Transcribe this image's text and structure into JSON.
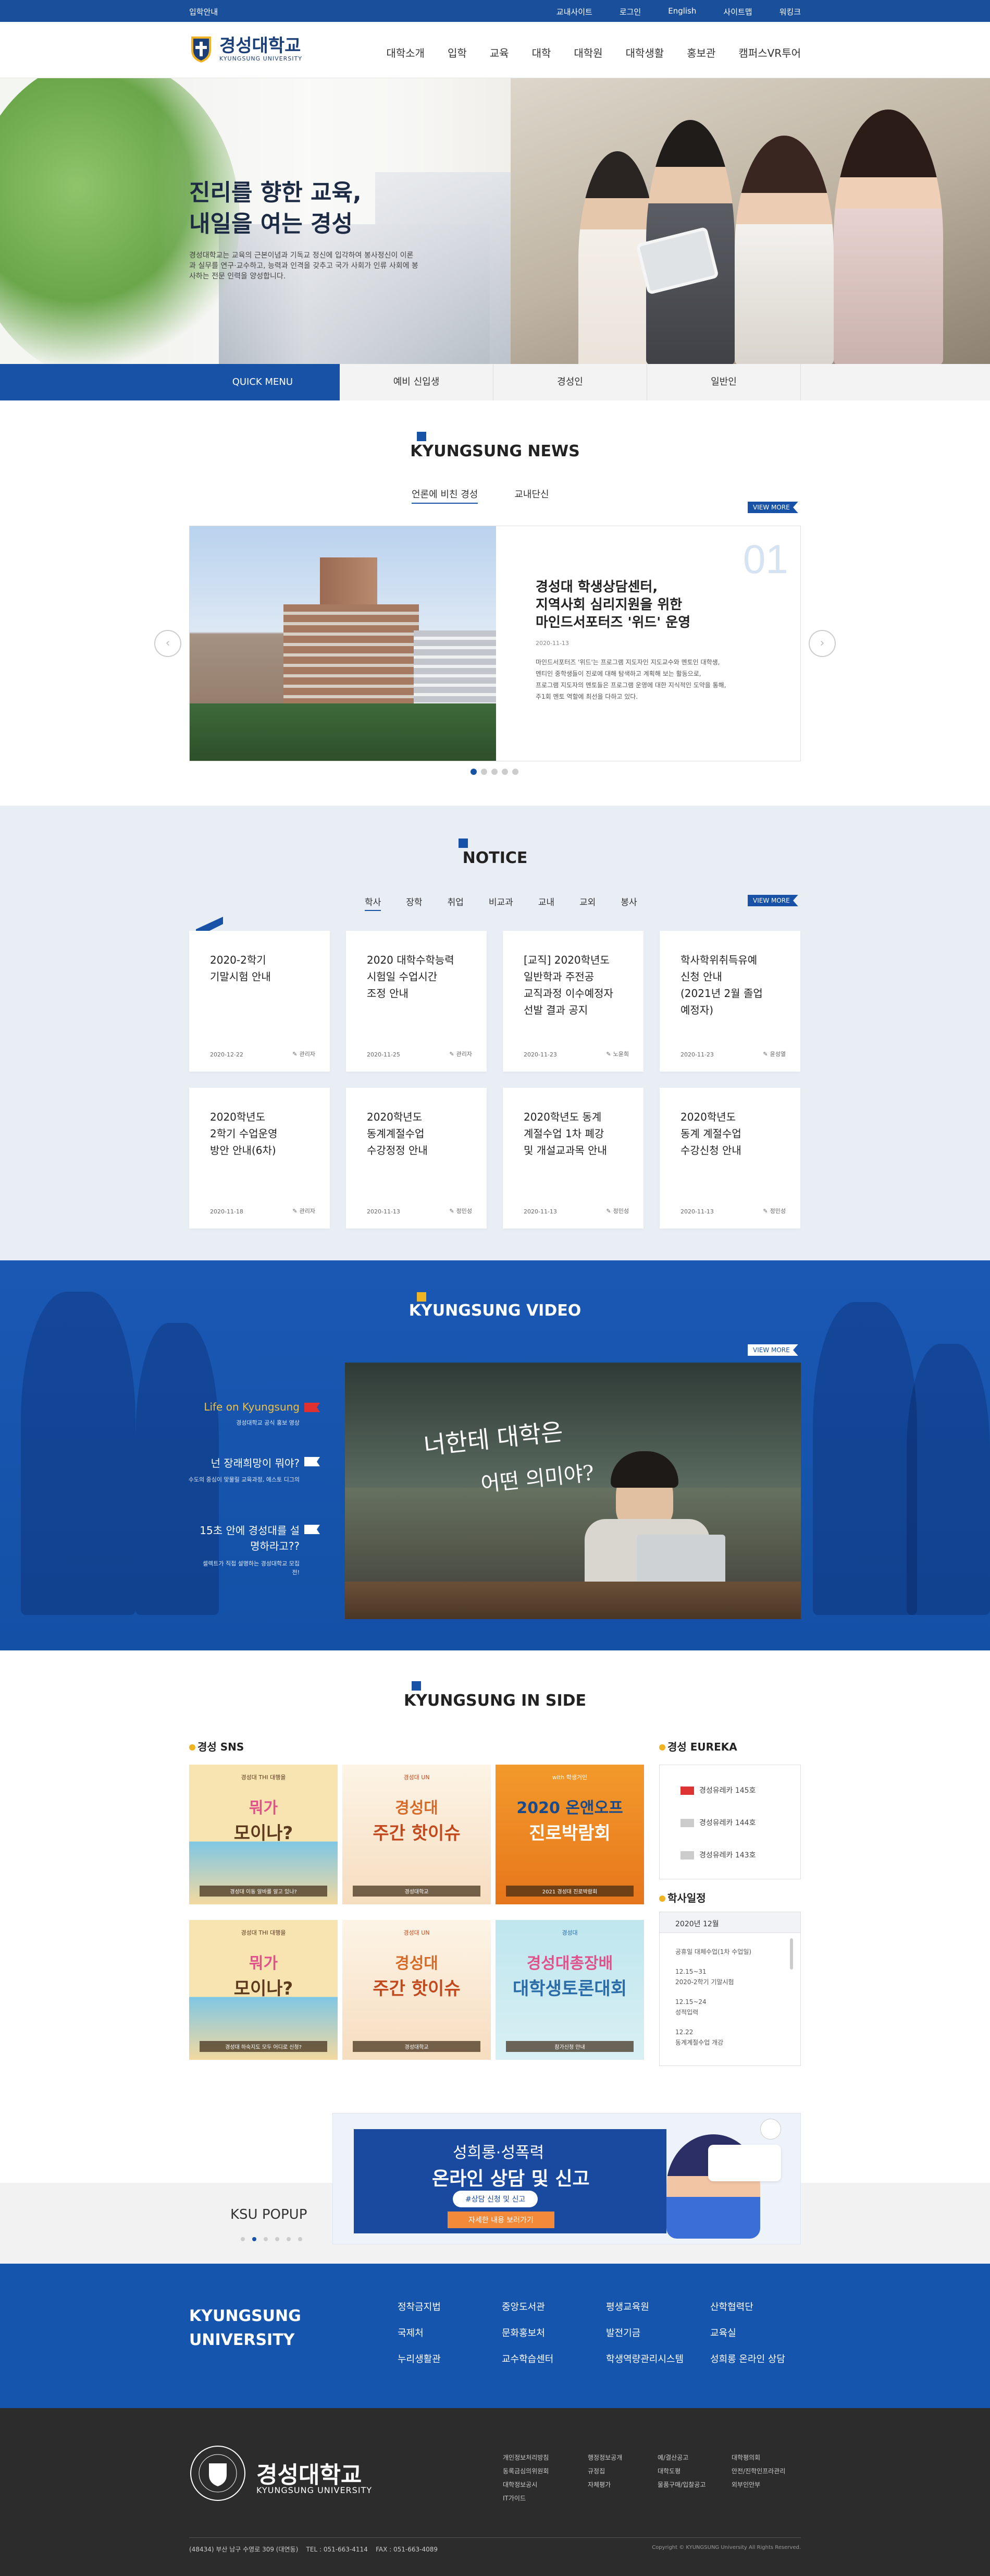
{
  "topbar": {
    "left": "입학안내",
    "links": [
      "교내사이트",
      "로그인",
      "English",
      "사이트맵",
      "워킹크"
    ]
  },
  "header": {
    "logo_kr": "경성대학교",
    "logo_en": "KYUNGSUNG UNIVERSITY",
    "nav": [
      "대학소개",
      "입학",
      "교육",
      "대학",
      "대학원",
      "대학생활",
      "홍보관",
      "캠퍼스VR투어"
    ]
  },
  "hero": {
    "title_line1": "진리를 향한 교육,",
    "title_line2": "내일을 여는 경성",
    "desc": "경성대학교는 교육의 근본이념과 기독교 정신에 입각하여 봉사정신이 이론과 실무를 연구·교수하고, 능력과 인격을 갖추고 국가 사회가 인류 사회에 봉사하는 전문 인력을 양성합니다."
  },
  "quick": {
    "label": "QUICK MENU",
    "items": [
      "예비 신입생",
      "경성인",
      "일반인"
    ]
  },
  "news": {
    "title": "KYUNGSUNG NEWS",
    "tabs": [
      "언론에 비친 경성",
      "교내단신"
    ],
    "viewmore": "VIEW MORE",
    "number": "01",
    "headline_1": "경성대 학생상담센터,",
    "headline_2": "지역사회 심리지원을 위한",
    "headline_3": "마인드서포터즈 '위드' 운영",
    "date": "2020-11-13",
    "body_1": "마인드서포터즈 '위드'는 프로그램 지도자인 지도교수와 멘토인 대학생,",
    "body_2": "멘티인 중학생들이 진로에 대해 탐색하고 계획해 보는 활동으로,",
    "body_3": "프로그램 지도자의 멘토들은 프로그램 운영에 대한 지식적인 도약을 통해,",
    "body_4": "주1회 멘토 역할에 최선을 다하고 있다."
  },
  "notice": {
    "title": "NOTICE",
    "tabs": [
      "학사",
      "장학",
      "취업",
      "비교과",
      "교내",
      "교외",
      "봉사"
    ],
    "viewmore": "VIEW MORE",
    "cards": [
      {
        "t1": "2020-2학기",
        "t2": "기말시험 안내",
        "t3": "",
        "t4": "",
        "date": "2020-12-22",
        "writer": "관리자"
      },
      {
        "t1": "2020 대학수학능력",
        "t2": "시험일 수업시간",
        "t3": "조정 안내",
        "t4": "",
        "date": "2020-11-25",
        "writer": "관리자"
      },
      {
        "t1": "[교직] 2020학년도",
        "t2": "일반학과 주전공",
        "t3": "교직과정 이수예정자",
        "t4": "선발 결과 공지",
        "date": "2020-11-23",
        "writer": "노윤희"
      },
      {
        "t1": "학사학위취득유예",
        "t2": "신청 안내",
        "t3": "(2021년 2월 졸업",
        "t4": "예정자)",
        "date": "2020-11-23",
        "writer": "윤성열"
      },
      {
        "t1": "2020학년도",
        "t2": "2학기 수업운영",
        "t3": "방안 안내(6차)",
        "t4": "",
        "date": "2020-11-18",
        "writer": "관리자"
      },
      {
        "t1": "2020학년도",
        "t2": "동계계절수업",
        "t3": "수강정정 안내",
        "t4": "",
        "date": "2020-11-13",
        "writer": "정민성"
      },
      {
        "t1": "2020학년도 동계",
        "t2": "계절수업 1차 폐강",
        "t3": "및 개설교과목 안내",
        "t4": "",
        "date": "2020-11-13",
        "writer": "정민성"
      },
      {
        "t1": "2020학년도",
        "t2": "동계 계절수업",
        "t3": "수강신청 안내",
        "t4": "",
        "date": "2020-11-13",
        "writer": "정민성"
      }
    ]
  },
  "video": {
    "title": "KYUNGSUNG VIDEO",
    "viewmore": "VIEW MORE",
    "items": [
      {
        "title": "Life on Kyungsung",
        "sub": "경성대학교 공식 홍보 영상"
      },
      {
        "title": "넌 장래희망이 뭐야?",
        "sub": "수도의 중심이 맞물릴 교육과정, 에스토 디그의"
      },
      {
        "title": "15초 안에 경성대를 설명하라고??",
        "sub": "셀렉트가 직접 설명하는 경성대학교 모집전!"
      }
    ],
    "caption_1": "너한테 대학은",
    "caption_2": "어떤 의미야?"
  },
  "inside": {
    "title": "KYUNGSUNG IN SIDE",
    "sns_label": "경성 SNS",
    "eureka_label": "경성 EUREKA",
    "eureka": [
      "경성유레카 145호",
      "경성유레카 144호",
      "경성유레카 143호"
    ],
    "schedule_label": "학사일정",
    "month": "2020년 12월",
    "schedule": [
      {
        "date": "",
        "text": "공휴일 대체수업(1차 수업일)"
      },
      {
        "date": "12.15~31",
        "text": "2020-2학기 기말시험"
      },
      {
        "date": "12.15~24",
        "text": "성적입력"
      },
      {
        "date": "12.22",
        "text": "동계계절수업 개강"
      }
    ],
    "sns_tiles": [
      {
        "t1": "경성대 THI 대행을",
        "t2": "뭐가",
        "t3": "모이나?",
        "t4": "경성대 이동 알바를 알고 있나?"
      },
      {
        "t1": "경성대 UN",
        "t2": "경성대",
        "t3": "주간 핫이슈",
        "t4": "경성대학교"
      },
      {
        "t1": "with 학생거인",
        "t2": "2020 온앤오프",
        "t3": "진로박람회",
        "t4": "2021 경성대 진로박람회"
      },
      {
        "t1": "경성대 THI 대행을",
        "t2": "뭐가",
        "t3": "모이나?",
        "t4": "경성대 하숙지도 모두 어디로 신청?"
      },
      {
        "t1": "경성대 UN",
        "t2": "경성대",
        "t3": "주간 핫이슈",
        "t4": "경성대학교"
      },
      {
        "t1": "경성대",
        "t2": "경성대총장배",
        "t3": "대학생토론대회",
        "t4": "참가신청 안내"
      }
    ]
  },
  "popup": {
    "label": "KSU POPUP",
    "banner_1": "성희롱·성폭력",
    "banner_2": "온라인 상담 및 신고",
    "pill": "#상담 신청 및 신고",
    "button": "자세한 내용 보러가기"
  },
  "footer": {
    "name_1": "KYUNGSUNG",
    "name_2": "UNIVERSITY",
    "links": [
      [
        "정착금지법",
        "국제처",
        "누리생활관"
      ],
      [
        "중앙도서관",
        "문화홍보처",
        "교수학습센터"
      ],
      [
        "평생교육원",
        "발전기금",
        "학생역량관리시스템"
      ],
      [
        "산학협력단",
        "교육실",
        "성희롱 온라인 상담"
      ]
    ],
    "logo_kr": "경성대학교",
    "logo_en": "KYUNGSUNG UNIVERSITY",
    "small": [
      [
        "개인정보처리방침",
        "동록금심의위원회",
        "대학정보공시",
        "IT가이드"
      ],
      [
        "행정정보공개",
        "규정집",
        "자체평가"
      ],
      [
        "예/결산공고",
        "대학도평",
        "물품구매/입찰공고"
      ],
      [
        "대학평의회",
        "안전/진학인프라관리",
        "외부인안부"
      ]
    ],
    "address": "(48434) 부산 남구 수영로 309 (대연동)",
    "tel": "TEL : 051-663-4114",
    "fax": "FAX : 051-663-4089",
    "copyright": "Copyright © KYUNGSUNG University All Rights Reserved."
  }
}
